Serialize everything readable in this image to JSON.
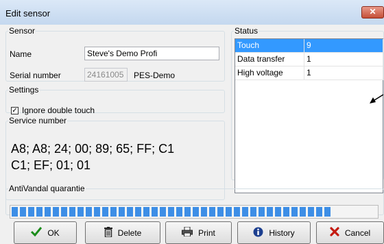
{
  "window": {
    "title": "Edit sensor",
    "close_glyph": "✕"
  },
  "sensor": {
    "legend": "Sensor",
    "name_label": "Name",
    "name_value": "Steve's Demo Profi",
    "serial_label": "Serial number",
    "serial_value": "24161005",
    "model": "PES-Demo"
  },
  "settings": {
    "legend": "Settings",
    "ignore_double_touch_label": "Ignore double touch",
    "ignore_double_touch_checked": true
  },
  "service": {
    "legend": "Service number",
    "line1": "A8; A8; 24; 00; 89; 65; FF; C1",
    "line2": "C1; EF; 01; 01"
  },
  "status": {
    "legend": "Status",
    "rows": [
      {
        "name": "Touch",
        "value": "9",
        "selected": true
      },
      {
        "name": "Data transfer",
        "value": "1",
        "selected": false
      },
      {
        "name": "High voltage",
        "value": "1",
        "selected": false
      }
    ]
  },
  "antivandal": {
    "legend": "AntiVandal quarantie",
    "progress_fraction": 0.89,
    "color": "#3d8ee6"
  },
  "buttons": {
    "ok": {
      "label": "OK",
      "icon": "checkmark-icon",
      "color": "#1a8c1a"
    },
    "delete": {
      "label": "Delete",
      "icon": "trash-icon"
    },
    "print": {
      "label": "Print",
      "icon": "printer-icon"
    },
    "history": {
      "label": "History",
      "icon": "info-icon",
      "color": "#1c3f8f"
    },
    "cancel": {
      "label": "Cancel",
      "icon": "x-icon",
      "color": "#c41a10"
    }
  }
}
